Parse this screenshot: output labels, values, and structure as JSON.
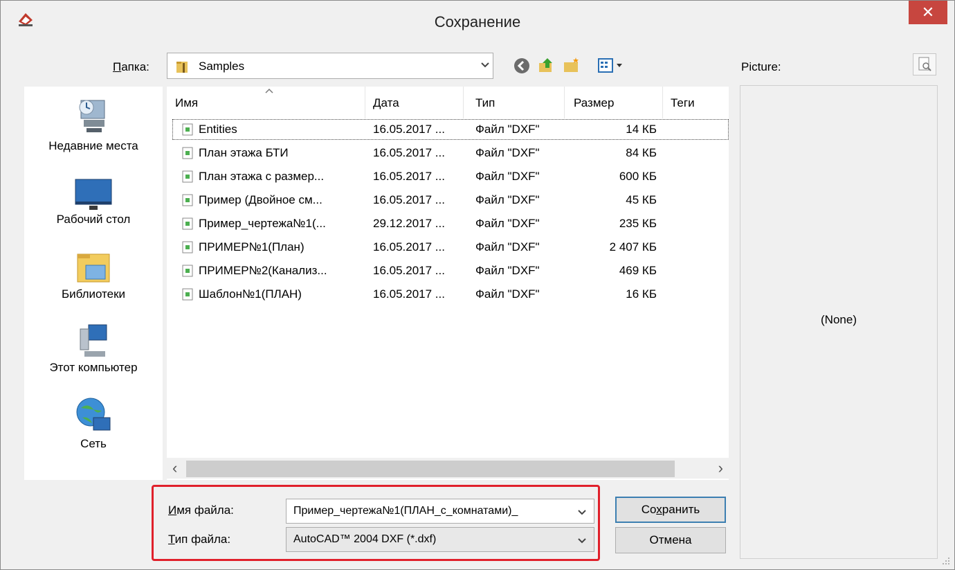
{
  "title": "Сохранение",
  "folder": {
    "label_underlined": "П",
    "label_rest": "апка:",
    "value": "Samples"
  },
  "preview": {
    "label": "Picture:",
    "none_text": "(None)"
  },
  "places": [
    {
      "label": "Недавние места",
      "icon": "recent-places-icon"
    },
    {
      "label": "Рабочий стол",
      "icon": "desktop-icon"
    },
    {
      "label": "Библиотеки",
      "icon": "libraries-icon"
    },
    {
      "label": "Этот компьютер",
      "icon": "computer-icon"
    },
    {
      "label": "Сеть",
      "icon": "network-icon"
    }
  ],
  "columns": [
    "Имя",
    "Дата",
    "Тип",
    "Размер",
    "Теги"
  ],
  "files": [
    {
      "name": "Entities",
      "date": "16.05.2017 ...",
      "type": "Файл \"DXF\"",
      "size": "14 КБ"
    },
    {
      "name": "План этажа БТИ",
      "date": "16.05.2017 ...",
      "type": "Файл \"DXF\"",
      "size": "84 КБ"
    },
    {
      "name": "План этажа с размер...",
      "date": "16.05.2017 ...",
      "type": "Файл \"DXF\"",
      "size": "600 КБ"
    },
    {
      "name": "Пример (Двойное см...",
      "date": "16.05.2017 ...",
      "type": "Файл \"DXF\"",
      "size": "45 КБ"
    },
    {
      "name": "Пример_чертежа№1(...",
      "date": "29.12.2017 ...",
      "type": "Файл \"DXF\"",
      "size": "235 КБ"
    },
    {
      "name": "ПРИМЕР№1(План)",
      "date": "16.05.2017 ...",
      "type": "Файл \"DXF\"",
      "size": "2 407 КБ"
    },
    {
      "name": "ПРИМЕР№2(Канализ...",
      "date": "16.05.2017 ...",
      "type": "Файл \"DXF\"",
      "size": "469 КБ"
    },
    {
      "name": "Шаблон№1(ПЛАН)",
      "date": "16.05.2017 ...",
      "type": "Файл \"DXF\"",
      "size": "16 КБ"
    }
  ],
  "filename": {
    "label_underlined": "И",
    "label_rest": "мя файла:",
    "value": "Пример_чертежа№1(ПЛАН_с_комнатами)_"
  },
  "filetype": {
    "label_underlined": "Т",
    "label_rest": "ип файла:",
    "value": "AutoCAD™ 2004 DXF (*.dxf)"
  },
  "buttons": {
    "save_pre": "Со",
    "save_underlined": "х",
    "save_post": "ранить",
    "cancel": "Отмена"
  },
  "colors": {
    "close_button": "#c7463f",
    "highlight": "#e0202b",
    "default_button_border": "#3c7fb1"
  }
}
